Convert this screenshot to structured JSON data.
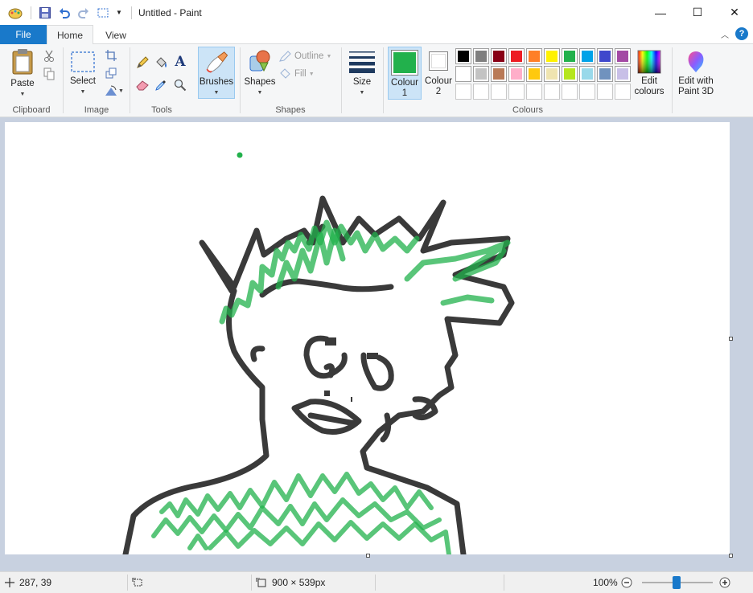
{
  "window": {
    "title": "Untitled - Paint",
    "controls": {
      "minimize": "—",
      "maximize": "☐",
      "close": "✕"
    }
  },
  "tabs": {
    "file": "File",
    "home": "Home",
    "view": "View"
  },
  "ribbon": {
    "clipboard": {
      "label": "Clipboard",
      "paste": "Paste"
    },
    "image": {
      "label": "Image",
      "select": "Select"
    },
    "tools": {
      "label": "Tools",
      "text_glyph": "A"
    },
    "brushes": {
      "label": "Brushes"
    },
    "shapes": {
      "label": "Shapes",
      "button": "Shapes",
      "outline": "Outline",
      "fill": "Fill"
    },
    "size": {
      "label": "Size"
    },
    "colours": {
      "label": "Colours",
      "colour1": "Colour 1",
      "colour1_value": "#22b14c",
      "colour2": "Colour 2",
      "colour2_value": "#ffffff",
      "edit_colours": "Edit colours",
      "palette_row1": [
        "#000000",
        "#7f7f7f",
        "#880015",
        "#ed1c24",
        "#ff7f27",
        "#fff200",
        "#22b14c",
        "#00a2e8",
        "#3f48cc",
        "#a349a4"
      ],
      "palette_row2": [
        "#ffffff",
        "#c3c3c3",
        "#b97a57",
        "#ffaec9",
        "#ffc90e",
        "#efe4b0",
        "#b5e61d",
        "#99d9ea",
        "#7092be",
        "#c8bfe7"
      ]
    },
    "edit_paint3d": "Edit with Paint 3D"
  },
  "status": {
    "cursor_pos": "287, 39",
    "image_size": "900 × 539px",
    "zoom": "100%"
  },
  "zoom_level": 100
}
